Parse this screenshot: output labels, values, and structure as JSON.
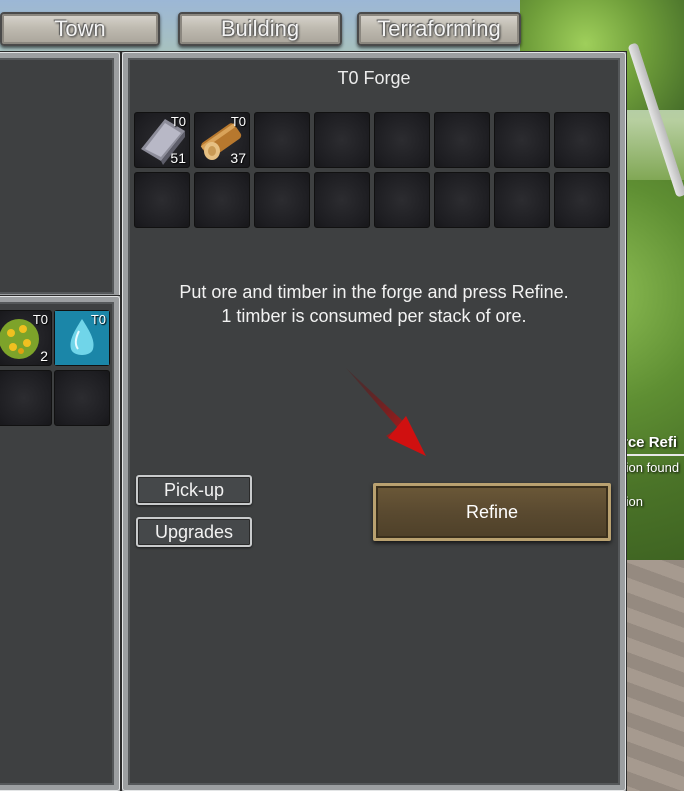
{
  "tabs": [
    {
      "label": "Town"
    },
    {
      "label": "Building"
    },
    {
      "label": "Terraforming"
    }
  ],
  "forge": {
    "title": "T0 Forge",
    "slots": [
      {
        "item": "iron-ingot-icon",
        "tier": "T0",
        "qty": "51"
      },
      {
        "item": "timber-log-icon",
        "tier": "T0",
        "qty": "37"
      }
    ],
    "instructions": [
      "Put ore and timber in the forge and press Refine.",
      "1 timber is consumed per stack of ore."
    ],
    "pickup_label": "Pick-up",
    "upgrades_label": "Upgrades",
    "refine_label": "Refine"
  },
  "inventory": {
    "slots": [
      {
        "item": "berry-bush-icon",
        "tier": "T0",
        "qty": "2"
      },
      {
        "item": "water-drop-icon",
        "tier": "T0",
        "qty": ""
      }
    ]
  },
  "side_info": {
    "title": "rce Refi",
    "line1": "tion found",
    "line2": "tion"
  },
  "colors": {
    "panel_bg": "#3e4041",
    "frame": "#9c9fa1",
    "refine_wood": "#5a4a30",
    "arrow": "#d01010"
  }
}
